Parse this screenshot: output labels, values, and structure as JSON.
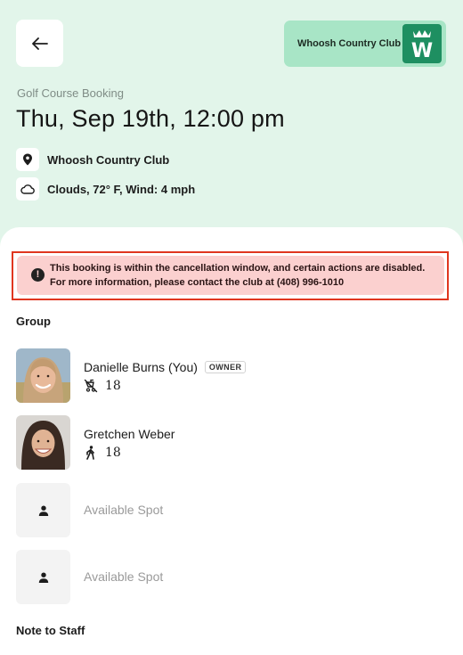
{
  "header": {
    "club_badge_name": "Whoosh Country Club",
    "club_logo_letter": "W",
    "subtitle": "Golf Course Booking",
    "title": "Thu, Sep 19th, 12:00 pm",
    "location": "Whoosh Country Club",
    "weather": "Clouds, 72° F, Wind: 4 mph"
  },
  "alert": {
    "icon_glyph": "!",
    "message": "This booking is within the cancellation window, and certain actions are disabled. For more information, please contact the club at (408) 996-1010"
  },
  "group": {
    "label": "Group",
    "members": [
      {
        "name": "Danielle Burns (You)",
        "badge": "OWNER",
        "mode_icon": "no-cart-icon",
        "holes": "18"
      },
      {
        "name": "Gretchen Weber",
        "badge": "",
        "mode_icon": "walking-icon",
        "holes": "18"
      }
    ],
    "available": [
      {
        "label": "Available Spot"
      },
      {
        "label": "Available Spot"
      }
    ]
  },
  "note": {
    "label": "Note to Staff"
  },
  "colors": {
    "header_bg": "#e2f5ea",
    "club_badge_bg": "#a8e5c6",
    "club_logo_bg": "#1e8f61",
    "alert_bg": "#fbd0cf",
    "alert_outline": "#e0361f"
  }
}
